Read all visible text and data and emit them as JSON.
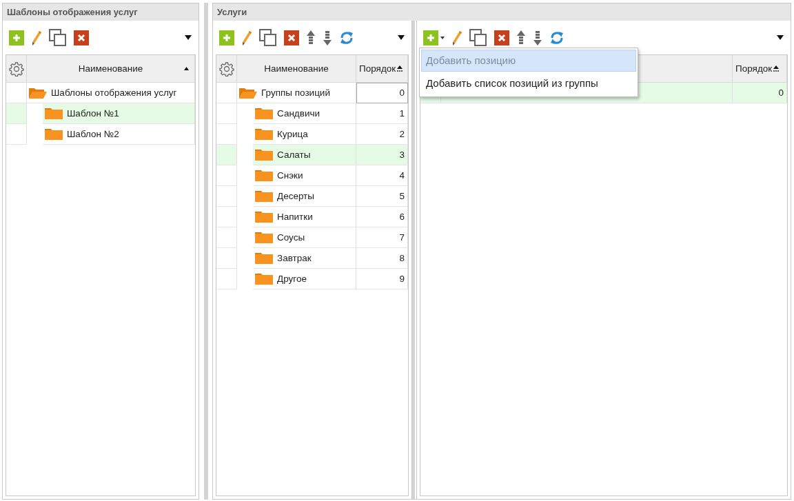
{
  "templates_panel": {
    "title": "Шаблоны отображения услуг",
    "toolbar": [
      {
        "kind": "add",
        "dropdown": false
      },
      {
        "kind": "edit"
      },
      {
        "kind": "copy"
      },
      {
        "kind": "delete"
      }
    ],
    "grid": {
      "columns": [
        {
          "label": "Наименование",
          "sorted": true
        }
      ],
      "tree": [
        {
          "label": "Шаблоны отображения услуг",
          "expanded": true,
          "selected": false,
          "children": [
            {
              "label": "Шаблон №1",
              "expanded": false,
              "selected": true
            },
            {
              "label": "Шаблон №2",
              "expanded": false,
              "selected": false
            }
          ]
        }
      ]
    }
  },
  "services_panel": {
    "title": "Услуги",
    "groups": {
      "toolbar": [
        {
          "kind": "add",
          "dropdown": false
        },
        {
          "kind": "edit"
        },
        {
          "kind": "copy"
        },
        {
          "kind": "delete"
        },
        {
          "kind": "up"
        },
        {
          "kind": "down"
        },
        {
          "kind": "refresh"
        }
      ],
      "columns": [
        {
          "label": "Наименование",
          "sorted": false
        },
        {
          "label": "Порядок",
          "sorted": true
        }
      ],
      "tree": [
        {
          "label": "Группы позиций",
          "order": "0",
          "expanded": true,
          "selected": false,
          "focused": true,
          "children": [
            {
              "label": "Сандвичи",
              "order": "1",
              "expanded": false,
              "selected": false
            },
            {
              "label": "Курица",
              "order": "2",
              "expanded": false,
              "selected": false
            },
            {
              "label": "Салаты",
              "order": "3",
              "expanded": false,
              "selected": true
            },
            {
              "label": "Снэки",
              "order": "4",
              "expanded": false,
              "selected": false
            },
            {
              "label": "Десерты",
              "order": "5",
              "expanded": false,
              "selected": false
            },
            {
              "label": "Напитки",
              "order": "6",
              "expanded": false,
              "selected": false
            },
            {
              "label": "Соусы",
              "order": "7",
              "expanded": false,
              "selected": false
            },
            {
              "label": "Завтрак",
              "order": "8",
              "expanded": false,
              "selected": false
            },
            {
              "label": "Другое",
              "order": "9",
              "expanded": false,
              "selected": false
            }
          ]
        }
      ]
    },
    "positions": {
      "toolbar": [
        {
          "kind": "add",
          "dropdown": true
        },
        {
          "kind": "edit"
        },
        {
          "kind": "copy"
        },
        {
          "kind": "delete"
        },
        {
          "kind": "up"
        },
        {
          "kind": "down"
        },
        {
          "kind": "refresh"
        }
      ],
      "columns": [
        {
          "label": "Порядок",
          "sorted": true
        }
      ],
      "rows": [
        {
          "order": "0",
          "selected": true
        }
      ],
      "menu": [
        {
          "label": "Добавить позицию",
          "highlighted": true,
          "disabled": true
        },
        {
          "label": "Добавить список позиций из группы",
          "highlighted": false,
          "disabled": false
        }
      ]
    }
  }
}
